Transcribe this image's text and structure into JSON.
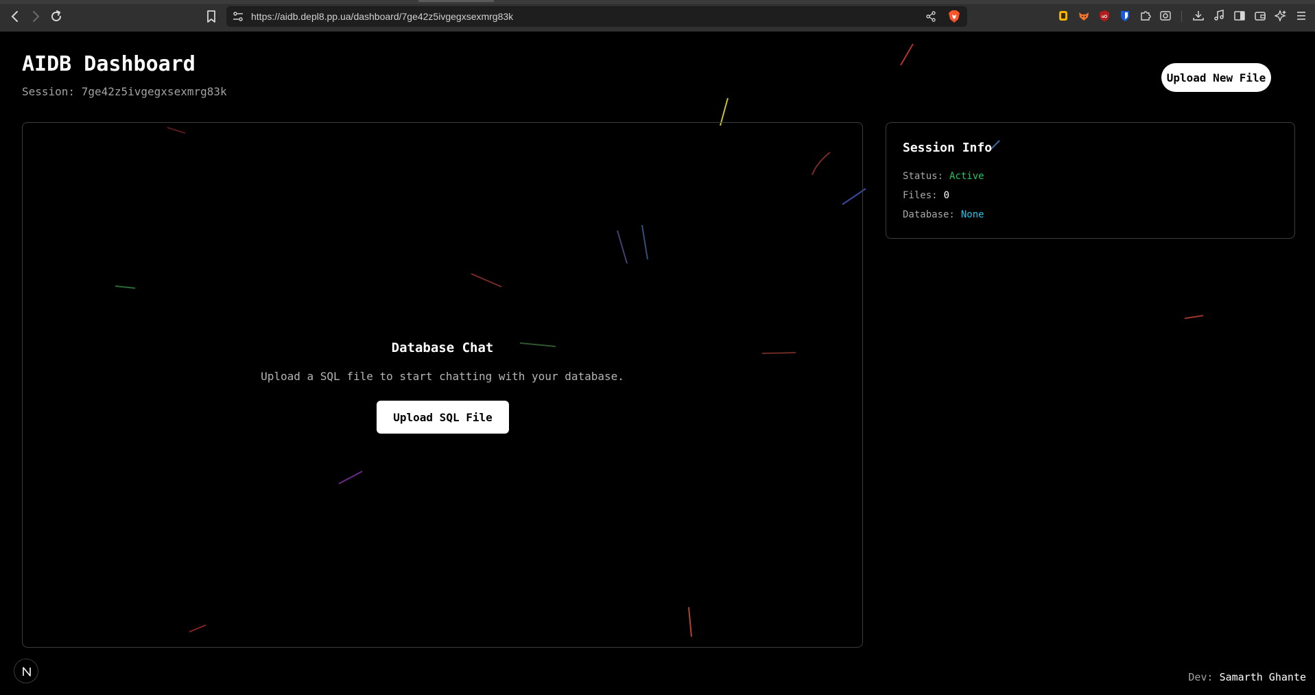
{
  "browser": {
    "url": "https://aidb.depl8.pp.ua/dashboard/7ge42z5ivgegxsexmrg83k",
    "nav_icons": [
      "back-icon",
      "forward-icon",
      "reload-icon",
      "bookmark-icon"
    ],
    "extension_icons": [
      "wallet-extension-icon",
      "fox-extension-icon",
      "ublock-icon",
      "bitwarden-icon",
      "puzzle-extensions-icon",
      "screenshot-icon",
      "downloads-icon",
      "media-icon",
      "sidebar-icon",
      "wallet-icon",
      "leo-ai-icon",
      "menu-icon"
    ]
  },
  "header": {
    "title": "AIDB Dashboard",
    "session_label": "Session:",
    "session_id": "7ge42z5ivgegxsexmrg83k",
    "upload_new_label": "Upload New File"
  },
  "chat": {
    "title": "Database Chat",
    "description": "Upload a SQL file to start chatting with your database.",
    "upload_label": "Upload SQL File"
  },
  "session_info": {
    "title": "Session Info",
    "status_label": "Status:",
    "status_value": "Active",
    "files_label": "Files:",
    "files_value": "0",
    "database_label": "Database:",
    "database_value": "None"
  },
  "footer": {
    "dev_label": "Dev:",
    "dev_name": "Samarth Ghante"
  },
  "colors": {
    "background": "#000000",
    "status_active": "#22c55e",
    "database_value": "#22c3e6",
    "button_bg": "#ffffff"
  }
}
